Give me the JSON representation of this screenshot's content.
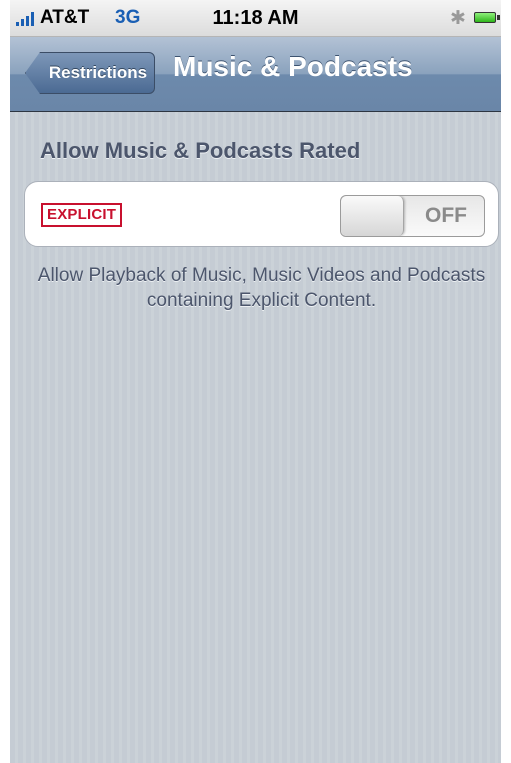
{
  "status_bar": {
    "carrier": "AT&T",
    "network": "3G",
    "time": "11:18 AM",
    "bluetooth_icon": "bluetooth-icon",
    "battery_icon": "battery-icon",
    "signal_icon": "signal-bars-icon"
  },
  "nav_bar": {
    "back_label": "Restrictions",
    "title": "Music & Podcasts"
  },
  "section": {
    "header": "Allow Music & Podcasts Rated",
    "row": {
      "badge": "EXPLICIT",
      "toggle_state": "OFF"
    },
    "footer": "Allow Playback of Music, Music Videos and Podcasts containing Explicit Content."
  },
  "colors": {
    "badge_red": "#c8102e",
    "network_blue": "#1a5fb4",
    "background": "#c5ccd4"
  }
}
